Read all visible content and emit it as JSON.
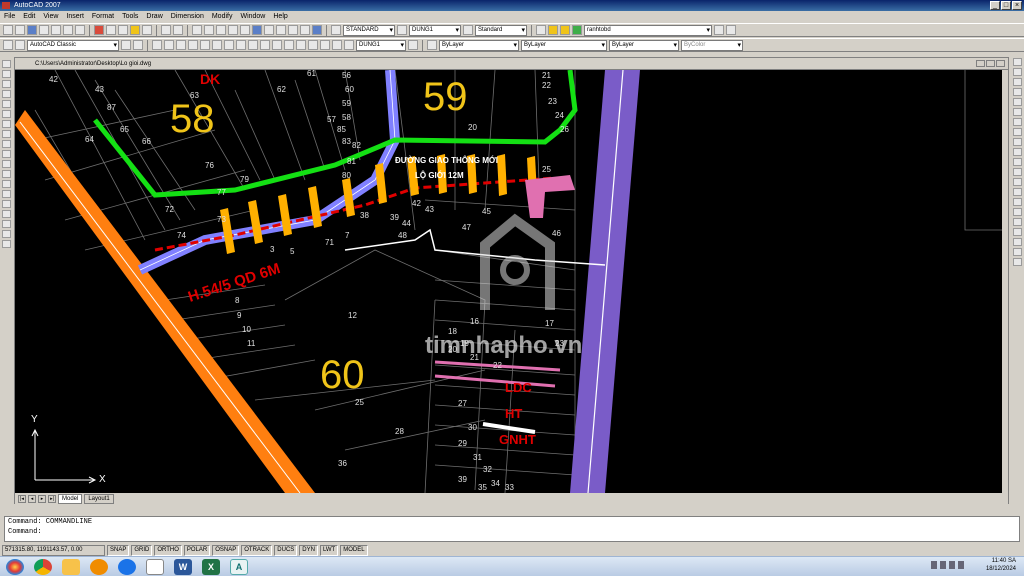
{
  "window": {
    "title": "AutoCAD 2007"
  },
  "menu": [
    "File",
    "Edit",
    "View",
    "Insert",
    "Format",
    "Tools",
    "Draw",
    "Dimension",
    "Modify",
    "Window",
    "Help"
  ],
  "toolbar": {
    "text_style": "STANDARD",
    "dim_style": "DUNG1",
    "table_style": "Standard",
    "layer": "ranhtobd",
    "workspace": "AutoCAD Classic",
    "mleader_style": "DUNG1",
    "color": "ByLayer",
    "linetype": "ByLayer",
    "lineweight": "ByLayer",
    "plotstyle": "ByColor"
  },
  "document": {
    "path": "C:\\Users\\Administrator\\Desktop\\Lo gioi.dwg"
  },
  "drawing": {
    "block_labels": [
      "58",
      "59",
      "60"
    ],
    "red_labels": [
      "DK",
      "H.54/5 QD 6M",
      "LDC",
      "HT",
      "GNHT"
    ],
    "road_note_line1": "ĐƯỜNG GIAO THÔNG MỚI",
    "road_note_line2": "LỘ GIỚI 12M",
    "watermark": "timnhapho.vn",
    "parcels": [
      {
        "n": "61"
      },
      {
        "n": "56"
      },
      {
        "n": "42"
      },
      {
        "n": "43"
      },
      {
        "n": "63"
      },
      {
        "n": "62"
      },
      {
        "n": "60"
      },
      {
        "n": "59"
      },
      {
        "n": "58"
      },
      {
        "n": "57"
      },
      {
        "n": "85"
      },
      {
        "n": "87"
      },
      {
        "n": "83"
      },
      {
        "n": "65"
      },
      {
        "n": "64"
      },
      {
        "n": "66"
      },
      {
        "n": "82"
      },
      {
        "n": "81"
      },
      {
        "n": "80"
      },
      {
        "n": "76"
      },
      {
        "n": "79"
      },
      {
        "n": "77"
      },
      {
        "n": "73"
      },
      {
        "n": "72"
      },
      {
        "n": "74"
      },
      {
        "n": "71"
      },
      {
        "n": "38"
      },
      {
        "n": "39"
      },
      {
        "n": "42"
      },
      {
        "n": "43"
      },
      {
        "n": "44"
      },
      {
        "n": "48"
      },
      {
        "n": "7"
      },
      {
        "n": "5"
      },
      {
        "n": "3"
      },
      {
        "n": "8"
      },
      {
        "n": "9"
      },
      {
        "n": "10"
      },
      {
        "n": "11"
      },
      {
        "n": "12"
      },
      {
        "n": "20"
      },
      {
        "n": "21"
      },
      {
        "n": "22"
      },
      {
        "n": "23"
      },
      {
        "n": "24"
      },
      {
        "n": "26"
      },
      {
        "n": "25"
      },
      {
        "n": "45"
      },
      {
        "n": "46"
      },
      {
        "n": "47"
      },
      {
        "n": "17"
      },
      {
        "n": "16"
      },
      {
        "n": "18"
      },
      {
        "n": "19"
      },
      {
        "n": "20"
      },
      {
        "n": "21"
      },
      {
        "n": "22"
      },
      {
        "n": "23"
      },
      {
        "n": "25"
      },
      {
        "n": "27"
      },
      {
        "n": "28"
      },
      {
        "n": "29"
      },
      {
        "n": "30"
      },
      {
        "n": "31"
      },
      {
        "n": "32"
      },
      {
        "n": "33"
      },
      {
        "n": "34"
      },
      {
        "n": "35"
      },
      {
        "n": "36"
      },
      {
        "n": "39"
      }
    ],
    "colors": {
      "green": "#14e014",
      "orange": "#ff7f10",
      "purple": "#7a5cc8",
      "yellow": "#ffb000",
      "red": "#e00000",
      "pink": "#e070b0"
    }
  },
  "ucs": {
    "x": "X",
    "y": "Y"
  },
  "layout_tabs": [
    "Model",
    "Layout1"
  ],
  "command": {
    "line1": "Command: COMMANDLINE",
    "line2": "Command:"
  },
  "status": {
    "coords": "571315.80, 1191143.57, 0.00",
    "modes": [
      "SNAP",
      "GRID",
      "ORTHO",
      "POLAR",
      "OSNAP",
      "OTRACK",
      "DUCS",
      "DYN",
      "LWT",
      "MODEL"
    ]
  },
  "clock": {
    "time": "11:40 SA",
    "date": "18/12/2024"
  }
}
